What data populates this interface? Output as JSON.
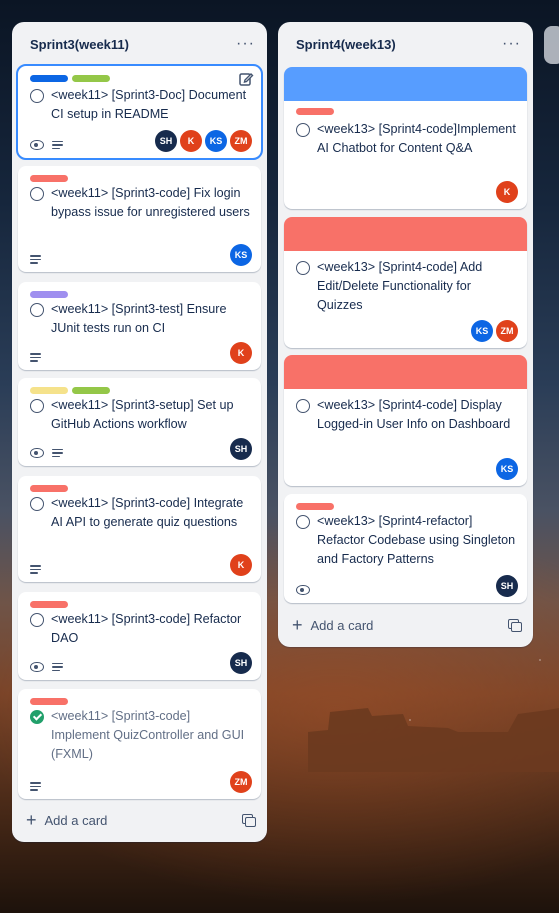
{
  "colors": {
    "blue": "#0c66e4",
    "green": "#94c748",
    "red": "#f87168",
    "purple": "#9f8fef",
    "yellow": "#f5e28b",
    "cover_blue": "#579dff",
    "cover_red": "#f87168",
    "avatar_navy": "#172b4d",
    "avatar_red": "#e0411b",
    "avatar_blue": "#0c66e4",
    "complete": "#22a06b"
  },
  "lists": [
    {
      "title": "Sprint3(week11)",
      "menu_icon": "ellipsis-icon",
      "add_card_label": "Add a card",
      "cards": [
        {
          "title": "<week11> [Sprint3-Doc] Document CI setup in README",
          "labels": [
            "blue",
            "green"
          ],
          "watched": true,
          "has_description": true,
          "members": [
            "SH",
            "K",
            "KS",
            "ZM"
          ]
        },
        {
          "title": "<week11> [Sprint3-code] Fix login bypass issue for unregistered users",
          "labels": [
            "red"
          ],
          "watched": false,
          "has_description": true,
          "members": [
            "KS"
          ]
        },
        {
          "title": "<week11> [Sprint3-test] Ensure JUnit tests run on CI",
          "labels": [
            "purple"
          ],
          "watched": false,
          "has_description": true,
          "members": [
            "K"
          ]
        },
        {
          "title": "<week11> [Sprint3-setup] Set up GitHub Actions workflow",
          "labels": [
            "yellow",
            "green"
          ],
          "watched": true,
          "has_description": true,
          "members": [
            "SH"
          ]
        },
        {
          "title": "<week11> [Sprint3-code] Integrate AI API to generate quiz questions",
          "labels": [
            "red"
          ],
          "watched": false,
          "has_description": true,
          "members": [
            "K"
          ]
        },
        {
          "title": "<week11> [Sprint3-code] Refactor DAO",
          "labels": [
            "red"
          ],
          "watched": true,
          "has_description": true,
          "members": [
            "SH"
          ]
        },
        {
          "title": "<week11> [Sprint3-code] Implement QuizController and GUI (FXML)",
          "labels": [
            "red"
          ],
          "watched": false,
          "has_description": true,
          "completed": true,
          "members": [
            "ZM"
          ]
        }
      ]
    },
    {
      "title": "Sprint4(week13)",
      "menu_icon": "ellipsis-icon",
      "add_card_label": "Add a card",
      "cards": [
        {
          "title": "<week13> [Sprint4-code]Implement AI Chatbot for Content Q&A",
          "cover": "cover_blue",
          "labels": [
            "red"
          ],
          "members": [
            "K"
          ]
        },
        {
          "title": "<week13> [Sprint4-code] Add Edit/Delete Functionality for Quizzes",
          "cover": "cover_red",
          "labels": [],
          "members": [
            "KS",
            "ZM"
          ]
        },
        {
          "title": "<week13> [Sprint4-code] Display Logged-in User Info on Dashboard",
          "cover": "cover_red",
          "labels": [],
          "members": [
            "KS"
          ]
        },
        {
          "title": "<week13> [Sprint4-refactor] Refactor Codebase using Singleton and Factory Patterns",
          "labels": [
            "red"
          ],
          "watched": true,
          "members": [
            "SH"
          ]
        }
      ]
    }
  ]
}
